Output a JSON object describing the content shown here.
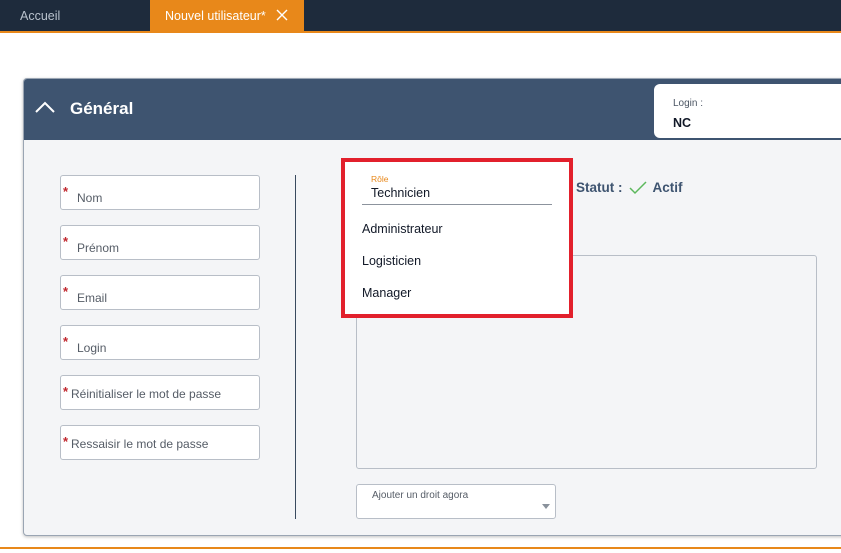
{
  "tabs": [
    {
      "label": "Accueil",
      "active": false
    },
    {
      "label": "Nouvel utilisateur*",
      "active": true
    }
  ],
  "colors": {
    "tabbar": "#1e2b3c",
    "accent": "#e8881a",
    "header": "#3e5470",
    "required": "#c0262d",
    "highlight": "#e2202c",
    "active_check": "#5cb85c"
  },
  "section": {
    "title": "Général"
  },
  "login_box": {
    "label": "Login :",
    "value": "NC"
  },
  "form": {
    "required_mark": "*",
    "fields": [
      {
        "placeholder": "Nom"
      },
      {
        "placeholder": "Prénom"
      },
      {
        "placeholder": "Email"
      },
      {
        "placeholder": "Login"
      },
      {
        "placeholder": "Réinitialiser le mot de passe"
      },
      {
        "placeholder": "Ressaisir le mot de passe"
      }
    ]
  },
  "role": {
    "label": "Rôle",
    "selected": "Technicien",
    "options": [
      "Administrateur",
      "Logisticien",
      "Manager"
    ]
  },
  "status": {
    "label": "Statut :",
    "value": "Actif",
    "icon": "check-icon"
  },
  "agora": {
    "placeholder": "Ajouter un droit agora"
  }
}
